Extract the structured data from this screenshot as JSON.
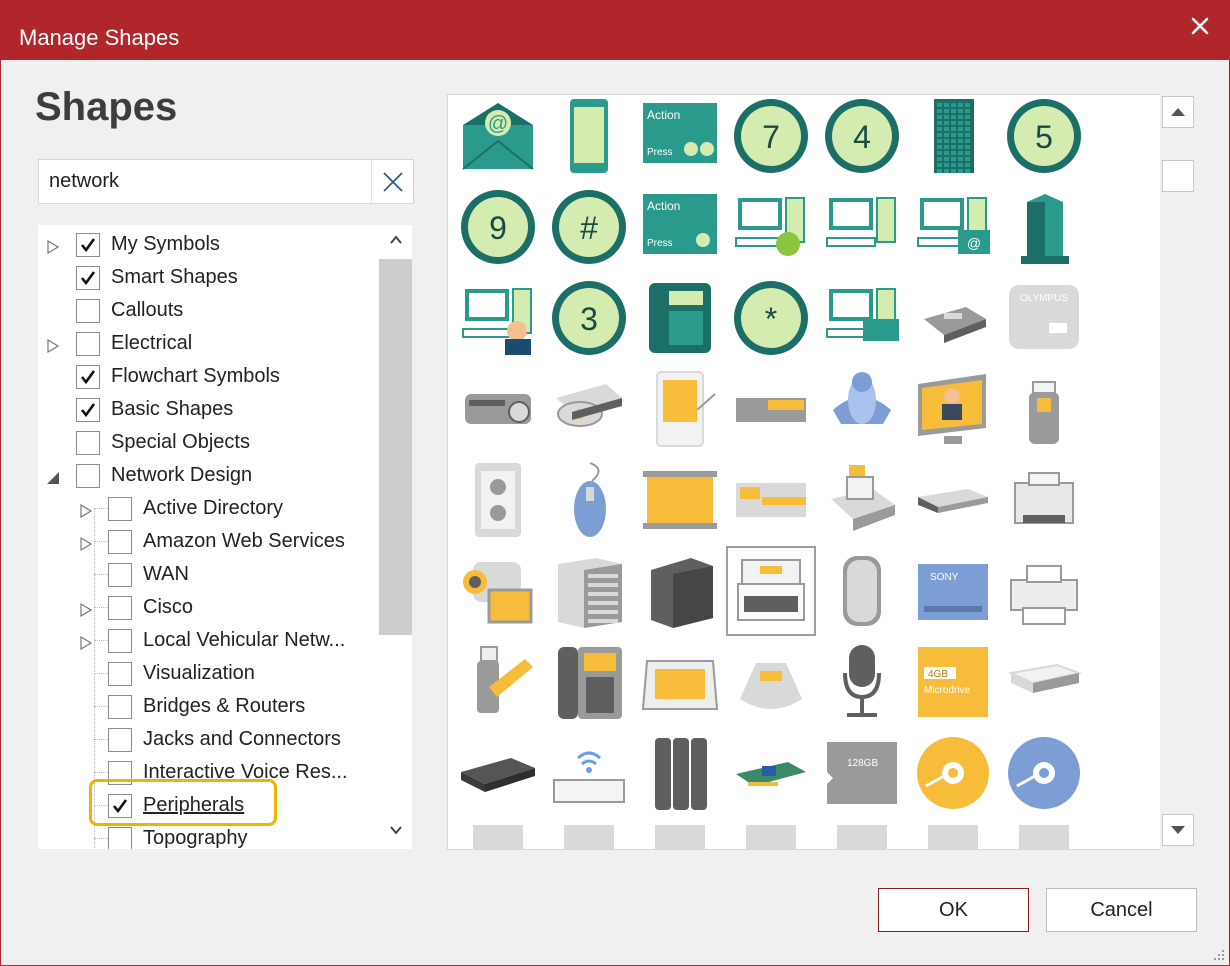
{
  "window": {
    "title": "Manage Shapes",
    "close_glyph": "✕"
  },
  "panel": {
    "heading": "Shapes"
  },
  "search": {
    "value": "network",
    "placeholder": ""
  },
  "tree": {
    "items": [
      {
        "label": "My Symbols",
        "checked": true,
        "expander": "collapsed",
        "level": 0
      },
      {
        "label": "Smart Shapes",
        "checked": true,
        "expander": "none",
        "level": 0
      },
      {
        "label": "Callouts",
        "checked": false,
        "expander": "none",
        "level": 0
      },
      {
        "label": "Electrical",
        "checked": false,
        "expander": "collapsed",
        "level": 0
      },
      {
        "label": "Flowchart Symbols",
        "checked": true,
        "expander": "none",
        "level": 0
      },
      {
        "label": "Basic Shapes",
        "checked": true,
        "expander": "none",
        "level": 0
      },
      {
        "label": "Special Objects",
        "checked": false,
        "expander": "none",
        "level": 0
      },
      {
        "label": "Network Design",
        "checked": false,
        "expander": "expanded",
        "level": 0
      },
      {
        "label": "Active Directory",
        "checked": false,
        "expander": "collapsed",
        "level": 1
      },
      {
        "label": "Amazon Web Services",
        "checked": false,
        "expander": "collapsed",
        "level": 1
      },
      {
        "label": "WAN",
        "checked": false,
        "expander": "none",
        "level": 1
      },
      {
        "label": "Cisco",
        "checked": false,
        "expander": "collapsed",
        "level": 1
      },
      {
        "label": "Local Vehicular Netw...",
        "checked": false,
        "expander": "collapsed",
        "level": 1
      },
      {
        "label": "Visualization",
        "checked": false,
        "expander": "none",
        "level": 1
      },
      {
        "label": "Bridges & Routers",
        "checked": false,
        "expander": "none",
        "level": 1
      },
      {
        "label": "Jacks and Connectors",
        "checked": false,
        "expander": "none",
        "level": 1
      },
      {
        "label": "Interactive Voice Res...",
        "checked": false,
        "expander": "none",
        "level": 1
      },
      {
        "label": "Peripherals",
        "checked": true,
        "expander": "none",
        "level": 1,
        "highlighted": true
      },
      {
        "label": "Topography",
        "checked": false,
        "expander": "none",
        "level": 1
      }
    ]
  },
  "shapes": {
    "rows": [
      [
        {
          "icon": "email-envelope"
        },
        {
          "icon": "mobile-phone"
        },
        {
          "icon": "action-button-two",
          "text1": "Action",
          "text2": "Press"
        },
        {
          "icon": "keypad-digit",
          "text": "7"
        },
        {
          "icon": "keypad-digit",
          "text": "4"
        },
        {
          "icon": "server-rack"
        },
        {
          "icon": "keypad-digit",
          "text": "5"
        }
      ],
      [
        {
          "icon": "keypad-digit",
          "text": "9"
        },
        {
          "icon": "keypad-digit",
          "text": "#"
        },
        {
          "icon": "action-button-one",
          "text1": "Action",
          "text2": "Press"
        },
        {
          "icon": "computer-globe"
        },
        {
          "icon": "computer-workstation"
        },
        {
          "icon": "computer-email"
        },
        {
          "icon": "office-building"
        }
      ],
      [
        {
          "icon": "computer-operator"
        },
        {
          "icon": "keypad-digit",
          "text": "3"
        },
        {
          "icon": "desk-phone"
        },
        {
          "icon": "keypad-digit",
          "text": "*"
        },
        {
          "icon": "computer-card"
        },
        {
          "icon": "voice-recorder"
        },
        {
          "icon": "olympus-recorder",
          "text": "OLYMPUS"
        }
      ],
      [
        {
          "icon": "projector"
        },
        {
          "icon": "optical-drive"
        },
        {
          "icon": "pda-stylus"
        },
        {
          "icon": "memory-stick"
        },
        {
          "icon": "joystick"
        },
        {
          "icon": "monitor-user"
        },
        {
          "icon": "usb-flash"
        }
      ],
      [
        {
          "icon": "power-outlet"
        },
        {
          "icon": "mouse"
        },
        {
          "icon": "projection-screen"
        },
        {
          "icon": "memory-card-long"
        },
        {
          "icon": "cash-register"
        },
        {
          "icon": "dvd-player"
        },
        {
          "icon": "laser-printer"
        }
      ],
      [
        {
          "icon": "camcorder"
        },
        {
          "icon": "cd-tower"
        },
        {
          "icon": "ups-unit"
        },
        {
          "icon": "typewriter"
        },
        {
          "icon": "router-box"
        },
        {
          "icon": "sony-memory-stick",
          "text": "SONY"
        },
        {
          "icon": "inkjet-printer"
        }
      ],
      [
        {
          "icon": "usb-swivel"
        },
        {
          "icon": "ip-phone"
        },
        {
          "icon": "flatbed-scanner"
        },
        {
          "icon": "conference-phone"
        },
        {
          "icon": "microphone"
        },
        {
          "icon": "microdrive",
          "text1": "4GB",
          "text2": "Microdrive"
        },
        {
          "icon": "card-reader"
        }
      ],
      [
        {
          "icon": "external-hdd"
        },
        {
          "icon": "wireless-keyboard"
        },
        {
          "icon": "hdd-array"
        },
        {
          "icon": "network-card"
        },
        {
          "icon": "micro-sd",
          "text": "128GB"
        },
        {
          "icon": "cd-disc-yellow"
        },
        {
          "icon": "cd-disc-blue"
        }
      ],
      [
        {
          "icon": "partial-shape"
        },
        {
          "icon": "partial-shape"
        },
        {
          "icon": "partial-shape"
        },
        {
          "icon": "partial-shape"
        },
        {
          "icon": "partial-shape"
        },
        {
          "icon": "partial-shape"
        },
        {
          "icon": "partial-shape"
        }
      ]
    ],
    "selected": {
      "row": 5,
      "col": 3
    }
  },
  "buttons": {
    "ok_label": "OK",
    "cancel_label": "Cancel"
  },
  "colors": {
    "titlebar": "#b0262b",
    "teal": "#2a9a8c",
    "yellow": "#f7bd3a",
    "highlight": "#f0b400"
  }
}
